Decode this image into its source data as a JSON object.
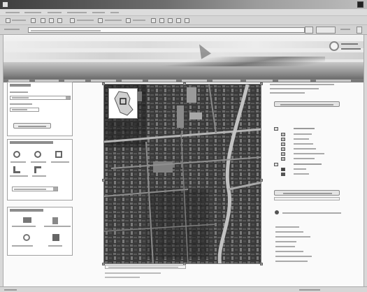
{
  "window": {
    "title": ""
  },
  "menubar": {
    "items": [
      "",
      "",
      "",
      "",
      "",
      ""
    ]
  },
  "toolbar": {
    "labels": [
      "",
      "",
      "",
      "",
      ""
    ]
  },
  "address": {
    "label": "",
    "value": "",
    "go_label": "",
    "links_label": ""
  },
  "banner": {
    "site_title": "",
    "nav_items": [
      "",
      "",
      "",
      "",
      "",
      "",
      "",
      "",
      "",
      "",
      ""
    ],
    "top_links": [
      "",
      ""
    ]
  },
  "left_panel": {
    "search": {
      "title": "",
      "field1_label": "",
      "field1_value": "",
      "field2_label": "",
      "field2_value": "",
      "button": ""
    },
    "navigation": {
      "title": "",
      "tools": [
        "",
        "",
        "",
        "",
        "",
        ""
      ],
      "select_value": ""
    },
    "overview": {
      "title": "",
      "items": [
        "",
        "",
        "",
        ""
      ]
    }
  },
  "map": {
    "scale_text": "",
    "footer_text": ""
  },
  "right_panel": {
    "top_links": [
      "",
      "",
      ""
    ],
    "map_button": "",
    "legend_title": "",
    "legend_items": [
      "",
      "",
      "",
      "",
      "",
      "",
      "",
      ""
    ],
    "legend_group2_title": "",
    "legend_group2_items": [
      "",
      ""
    ],
    "layer_button": "",
    "info_text": "",
    "bottom_links": [
      "",
      "",
      "",
      "",
      "",
      "",
      "",
      ""
    ]
  },
  "status": {
    "left": "",
    "right": ""
  }
}
